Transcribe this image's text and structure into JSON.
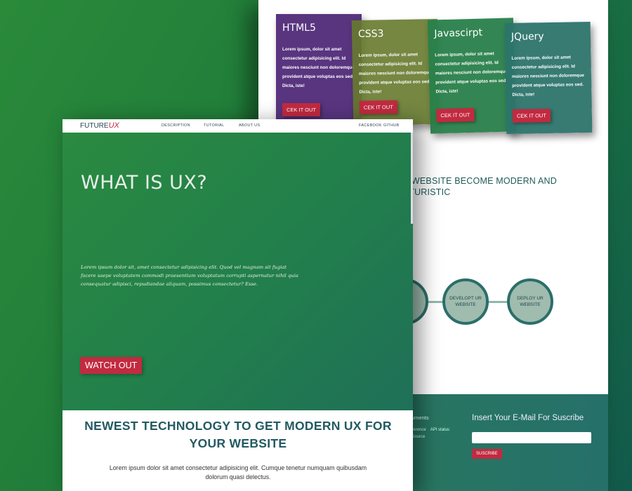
{
  "cards": [
    {
      "title": "HTML5",
      "text": "Lorem ipsum, dolor sit amet consectetur adipisicing elit. Id maiores nesciunt non doloremque provident atque voluptas eos sed. Dicta, iste!",
      "button": "CEK IT OUT"
    },
    {
      "title": "CSS3",
      "text": "Lorem ipsum, dolor sit amet consectetur adipisicing elit. Id maiores nesciunt non doloremque provident atque voluptas eos sed. Dicta, iste!",
      "button": "CEK IT OUT"
    },
    {
      "title": "Javascirpt",
      "text": "Lorem ipsum, dolor sit amet consectetur adipisicing elit. Id maiores nesciunt non doloremque provident atque voluptas eos sed. Dicta, iste!",
      "button": "CEK IT OUT"
    },
    {
      "title": "JQuery",
      "text": "Lorem ipsum, dolor sit amet consectetur adipisicing elit. Id maiores nesciunt non doloremque provident atque voluptas eos sed. Dicta, iste!",
      "button": "CEK IT OUT"
    }
  ],
  "back_heading": "R WEBSITE BECOME MODERN AND UTURISTIC",
  "steps": [
    "",
    "DEVELOPT UR WEBSITE",
    "DEPLOY UR WEBSITE"
  ],
  "footer": {
    "doc_title": "ocuments",
    "links": [
      "I reference",
      "API status",
      "en Source"
    ],
    "subscribe_title": "Insert Your E-Mail For Suscribe",
    "subscribe_button": "SUSCRIBE"
  },
  "nav": {
    "logo_main": "FUTURE",
    "logo_accent": "UX",
    "links": [
      "DESCRIPTION",
      "TUTORIAL",
      "ABOUT US"
    ],
    "social": [
      "FACEBOOK",
      "GITHUB"
    ]
  },
  "hero": {
    "title": "WHAT IS UX?",
    "text": "Lorem ipsum dolor sit, amet consectetur adipisicing elit. Quod vel magnam sit fugiat facere saepe voluptatem commodi praesentium voluptatum corrupti aspernatur nihil quia consequatur adipisci, repudiandae aliquam, possimus consectetur? Esse.",
    "button": "WATCH OUT"
  },
  "section": {
    "heading": "NEWEST TECHNOLOGY TO GET MODERN UX FOR YOUR WEBSITE",
    "text": "Lorem ipsum dolor sit amet consectetur adipisicing elit. Cumque tenetur numquam quibusdam dolorum quasi delectus."
  },
  "colors": {
    "accent": "#c22a40",
    "hero_green": "#22804a",
    "heading_teal": "#235a62"
  }
}
